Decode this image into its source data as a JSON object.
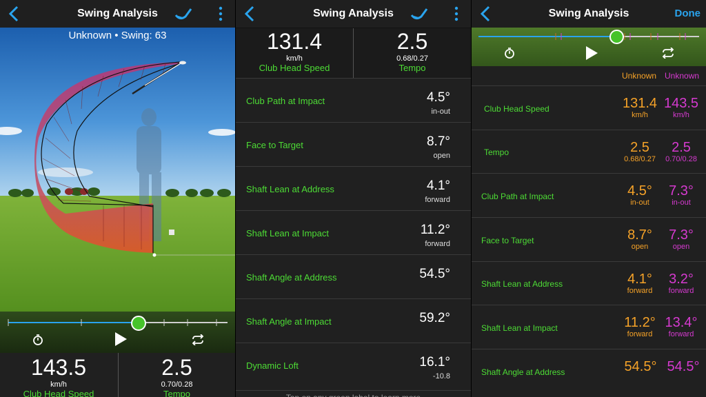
{
  "app": {
    "title": "Swing Analysis",
    "done_label": "Done"
  },
  "panel1": {
    "subtitle": "Unknown • Swing: 63",
    "stats": [
      {
        "value": "143.5",
        "unit": "km/h",
        "label": "Club Head Speed"
      },
      {
        "value": "2.5",
        "unit": "0.70/0.28",
        "label": "Tempo"
      }
    ],
    "slider_position": 0.58
  },
  "panel2": {
    "stats": [
      {
        "value": "131.4",
        "unit": "km/h",
        "label": "Club Head Speed"
      },
      {
        "value": "2.5",
        "unit": "0.68/0.27",
        "label": "Tempo"
      }
    ],
    "rows": [
      {
        "label": "Club Path at Impact",
        "value": "4.5°",
        "sub": "in-out"
      },
      {
        "label": "Face to Target",
        "value": "8.7°",
        "sub": "open"
      },
      {
        "label": "Shaft Lean at Address",
        "value": "4.1°",
        "sub": "forward"
      },
      {
        "label": "Shaft Lean at Impact",
        "value": "11.2°",
        "sub": "forward"
      },
      {
        "label": "Shaft Angle at Address",
        "value": "54.5°",
        "sub": ""
      },
      {
        "label": "Shaft Angle at Impact",
        "value": "59.2°",
        "sub": ""
      },
      {
        "label": "Dynamic Loft",
        "value": "16.1°",
        "sub": "-10.8"
      }
    ],
    "footer": "Tap on any green label to learn more"
  },
  "panel3": {
    "columns": [
      "Unknown",
      "Unknown"
    ],
    "slider_position": 0.62,
    "rows": [
      {
        "label": "Club Head Speed",
        "a": "131.4",
        "a_sub": "km/h",
        "b": "143.5",
        "b_sub": "km/h"
      },
      {
        "label": "Tempo",
        "a": "2.5",
        "a_sub": "0.68/0.27",
        "b": "2.5",
        "b_sub": "0.70/0.28"
      },
      {
        "label": "Club Path at Impact",
        "a": "4.5°",
        "a_sub": "in-out",
        "b": "7.3°",
        "b_sub": "in-out"
      },
      {
        "label": "Face to Target",
        "a": "8.7°",
        "a_sub": "open",
        "b": "7.3°",
        "b_sub": "open"
      },
      {
        "label": "Shaft Lean at Address",
        "a": "4.1°",
        "a_sub": "forward",
        "b": "3.2°",
        "b_sub": "forward"
      },
      {
        "label": "Shaft Lean at Impact",
        "a": "11.2°",
        "a_sub": "forward",
        "b": "13.4°",
        "b_sub": "forward"
      },
      {
        "label": "Shaft Angle at Address",
        "a": "54.5°",
        "a_sub": "",
        "b": "54.5°",
        "b_sub": ""
      }
    ]
  },
  "icons": [
    "back-icon",
    "club-icon",
    "more-icon",
    "timer-icon",
    "play-icon",
    "repeat-icon"
  ],
  "colors": {
    "accent_green": "#4ddc35",
    "accent_blue": "#2aa4ee",
    "orange": "#f5a228",
    "magenta": "#d63ad0",
    "background": "#202020"
  }
}
